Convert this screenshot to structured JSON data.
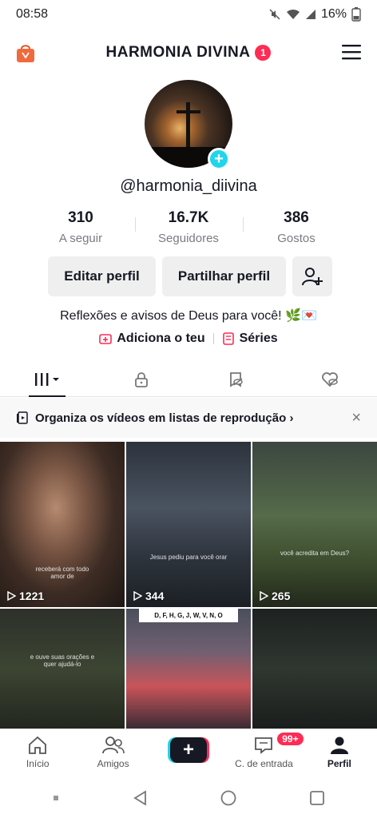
{
  "status": {
    "time": "08:58",
    "battery": "16%"
  },
  "header": {
    "title": "HARMONIA DIVINA",
    "notification_count": "1"
  },
  "profile": {
    "username": "@harmonia_diivina",
    "bio": "Reflexões e avisos de Deus para você! 🌿💌"
  },
  "stats": [
    {
      "value": "310",
      "label": "A seguir"
    },
    {
      "value": "16.7K",
      "label": "Seguidores"
    },
    {
      "value": "386",
      "label": "Gostos"
    }
  ],
  "actions": {
    "edit": "Editar perfil",
    "share": "Partilhar perfil"
  },
  "links": {
    "add": "Adiciona o teu",
    "series": "Séries"
  },
  "playlist_banner": {
    "text": "Organiza os vídeos em listas de reprodução",
    "arrow": "›",
    "close": "×"
  },
  "videos": [
    {
      "views": "1221",
      "caption": "receberá com todo amor de"
    },
    {
      "views": "344",
      "caption": "Jesus pediu para você orar"
    },
    {
      "views": "265",
      "caption": "você acredita em Deus?"
    },
    {
      "caption": "e ouve suas orações e quer ajudá-lo"
    },
    {
      "letters": "D, F, H, G, J, W, V, N, O"
    },
    {}
  ],
  "bottom_nav": [
    {
      "label": "Início"
    },
    {
      "label": "Amigos"
    },
    {
      "label": ""
    },
    {
      "label": "C. de entrada",
      "badge": "99+"
    },
    {
      "label": "Perfil"
    }
  ]
}
